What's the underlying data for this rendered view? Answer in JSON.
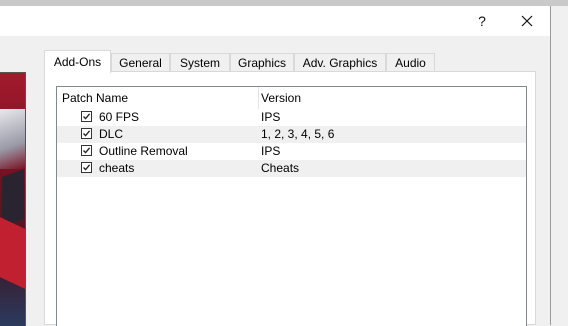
{
  "window": {
    "help_label": "?",
    "close_icon": "close-icon"
  },
  "tabs": [
    {
      "label": "Add-Ons",
      "selected": true
    },
    {
      "label": "General",
      "selected": false
    },
    {
      "label": "System",
      "selected": false
    },
    {
      "label": "Graphics",
      "selected": false
    },
    {
      "label": "Adv. Graphics",
      "selected": false
    },
    {
      "label": "Audio",
      "selected": false
    }
  ],
  "patch_list": {
    "columns": [
      "Patch Name",
      "Version"
    ],
    "rows": [
      {
        "name": "60 FPS",
        "version": "IPS",
        "checked": true
      },
      {
        "name": "DLC",
        "version": "1, 2, 3, 4, 5, 6",
        "checked": true
      },
      {
        "name": "Outline Removal",
        "version": "IPS",
        "checked": true
      },
      {
        "name": "cheats",
        "version": "Cheats",
        "checked": true
      }
    ]
  },
  "colors": {
    "row_alt": "#f0f0f0",
    "panel_border": "#d9d9d9",
    "list_border": "#828790"
  }
}
